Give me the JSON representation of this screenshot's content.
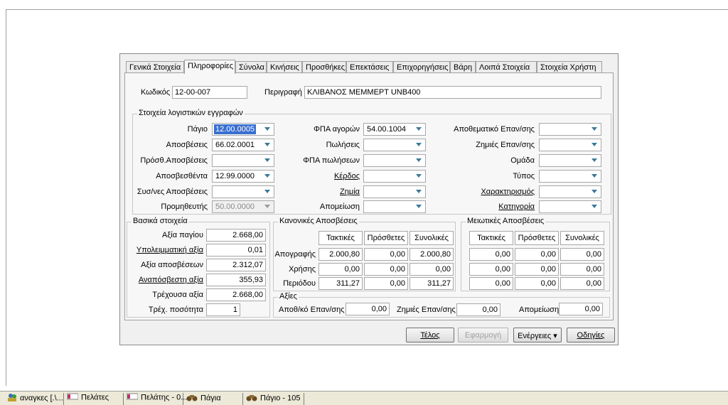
{
  "tabs": [
    "Γενικά Στοιχεία",
    "Πληροφορίες",
    "Σύνολα",
    "Κινήσεις",
    "Προσθήκες",
    "Επεκτάσεις",
    "Επιχορηγήσεις",
    "Βάρη",
    "Λοιπά Στοιχεία",
    "Στοιχεία Χρήστη"
  ],
  "header": {
    "code_label": "Κωδικός",
    "code_value": "12-00-007",
    "desc_label": "Περιγραφή",
    "desc_value": "ΚΛΙΒΑΝΟΣ ΜΕΜΜΕΡΤ UNB400"
  },
  "accounting": {
    "title": "Στοιχεία λογιστικών εγγραφών",
    "col1": [
      {
        "label": "Πάγιο",
        "value": "12.00.0005"
      },
      {
        "label": "Αποσβέσεις",
        "value": "66.02.0001"
      },
      {
        "label": "Πρόσθ.Αποσβέσεις",
        "value": ""
      },
      {
        "label": "Αποσβεσθέντα",
        "value": "12.99.0000"
      },
      {
        "label": "Συσ/νες Αποσβέσεις",
        "value": ""
      },
      {
        "label": "Προμηθευτής",
        "value": "50.00.0000"
      }
    ],
    "col2": [
      {
        "label": "ΦΠΑ αγορών",
        "value": "54.00.1004"
      },
      {
        "label": "Πωλήσεις",
        "value": ""
      },
      {
        "label": "ΦΠΑ πωλήσεων",
        "value": ""
      },
      {
        "label": "Κέρδος",
        "value": ""
      },
      {
        "label": "Ζημία",
        "value": ""
      },
      {
        "label": "Απομείωση",
        "value": ""
      }
    ],
    "col3": [
      {
        "label": "Αποθεματικό Επαν/σης",
        "value": ""
      },
      {
        "label": "Ζημιές Επαν/σης",
        "value": ""
      },
      {
        "label": "Ομάδα",
        "value": ""
      },
      {
        "label": "Τύπος",
        "value": ""
      },
      {
        "label": "Χαρακτηρισμός",
        "value": ""
      },
      {
        "label": "Κατηγορία",
        "value": ""
      }
    ]
  },
  "basic": {
    "title": "Βασικά στοιχεία",
    "rows": [
      {
        "label": "Αξία παγίου",
        "value": "2.668,00"
      },
      {
        "label": "Υπολειμματική αξία",
        "value": "0,01"
      },
      {
        "label": "Αξία αποσβέσεων",
        "value": "2.312,07"
      },
      {
        "label": "Αναπόσβεστη αξία",
        "value": "355,93"
      },
      {
        "label": "Τρέχουσα αξία",
        "value": "2.668,00"
      },
      {
        "label": "Τρέχ. ποσότητα",
        "value": "1"
      }
    ]
  },
  "normal_dep": {
    "title": "Κανονικές Αποσβέσεις",
    "headers": [
      "Τακτικές",
      "Πρόσθετες",
      "Συνολικές"
    ],
    "row_labels": [
      "Απογραφής",
      "Χρήσης",
      "Περιόδου"
    ],
    "rows": [
      [
        "2.000,80",
        "0,00",
        "2.000,80"
      ],
      [
        "0,00",
        "0,00",
        "0,00"
      ],
      [
        "311,27",
        "0,00",
        "311,27"
      ]
    ]
  },
  "reduced_dep": {
    "title": "Μειωτικές Αποσβέσεις",
    "headers": [
      "Τακτικές",
      "Πρόσθετες",
      "Συνολικές"
    ],
    "rows": [
      [
        "0,00",
        "0,00",
        "0,00"
      ],
      [
        "0,00",
        "0,00",
        "0,00"
      ],
      [
        "0,00",
        "0,00",
        "0,00"
      ]
    ]
  },
  "values": {
    "title": "Αξίες",
    "reserve_label": "Αποθ/κό Επαν/σης",
    "reserve_value": "0,00",
    "loss_label": "Ζημιές Επαν/σης",
    "loss_value": "0,00",
    "impair_label": "Απομείωση",
    "impair_value": "0,00"
  },
  "buttons": {
    "end": "Τέλος",
    "apply": "Εφαρμογή",
    "actions": "Ενέργειες",
    "help": "Οδηγίες"
  },
  "taskbar": [
    "αναγκες [.\\...",
    "Πελάτες",
    "Πελάτης - 0...",
    "Πάγια",
    "Πάγιο - 105"
  ]
}
